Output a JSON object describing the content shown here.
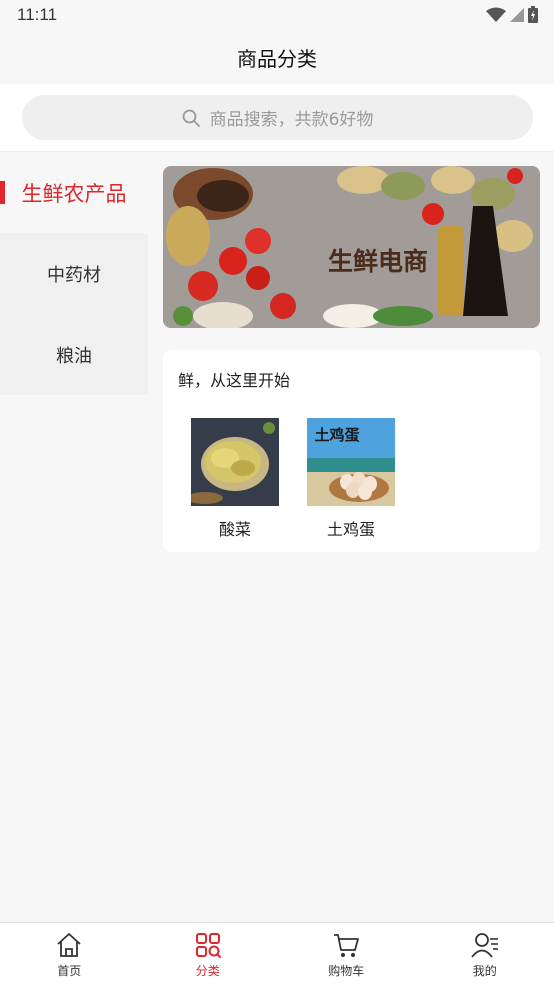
{
  "status_bar": {
    "time": "11:11"
  },
  "header": {
    "title": "商品分类"
  },
  "search": {
    "placeholder": "商品搜索，共款6好物"
  },
  "sidebar": {
    "items": [
      {
        "label": "生鲜农产品",
        "active": true
      },
      {
        "label": "中药材",
        "active": false
      },
      {
        "label": "粮油",
        "active": false
      }
    ]
  },
  "banner": {
    "text": "生鲜电商"
  },
  "section": {
    "title": "鲜，从这里开始",
    "products": [
      {
        "name": "酸菜"
      },
      {
        "name": "土鸡蛋",
        "image_text": "土鸡蛋"
      }
    ]
  },
  "tabbar": {
    "items": [
      {
        "label": "首页",
        "icon": "home-icon"
      },
      {
        "label": "分类",
        "icon": "category-icon",
        "active": true
      },
      {
        "label": "购物车",
        "icon": "cart-icon"
      },
      {
        "label": "我的",
        "icon": "profile-icon"
      }
    ]
  },
  "colors": {
    "accent": "#e0262b",
    "background": "#f7f7f7"
  }
}
